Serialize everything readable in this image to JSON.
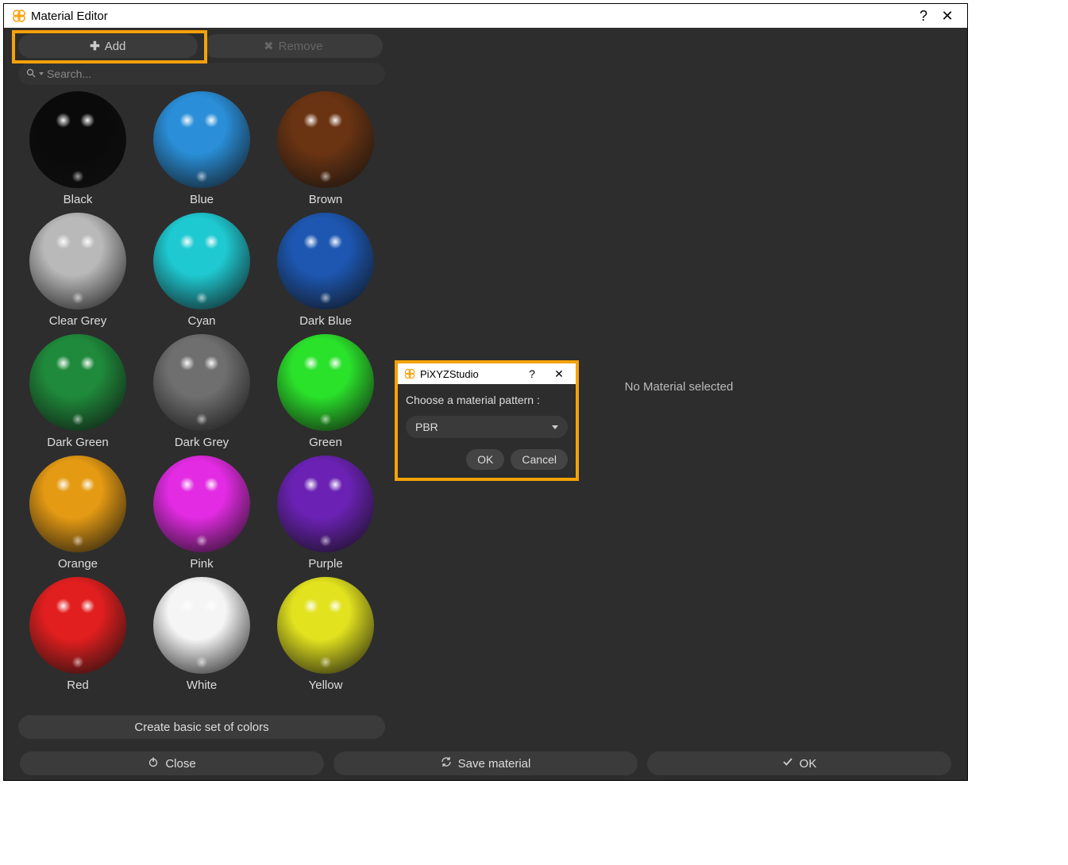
{
  "window": {
    "title": "Material Editor",
    "help": "?",
    "close": "✕"
  },
  "toolbar": {
    "add_label": "Add",
    "remove_label": "Remove"
  },
  "search": {
    "placeholder": "Search..."
  },
  "materials": [
    {
      "label": "Black",
      "color": "#0a0a0a"
    },
    {
      "label": "Blue",
      "color": "#2a8fd8"
    },
    {
      "label": "Brown",
      "color": "#6a3413"
    },
    {
      "label": "Clear Grey",
      "color": "#b9b9b9"
    },
    {
      "label": "Cyan",
      "color": "#1fc9d1"
    },
    {
      "label": "Dark Blue",
      "color": "#1d57b1"
    },
    {
      "label": "Dark Green",
      "color": "#1f8a3b"
    },
    {
      "label": "Dark Grey",
      "color": "#6f6f6f"
    },
    {
      "label": "Green",
      "color": "#2be22b"
    },
    {
      "label": "Orange",
      "color": "#e49a13"
    },
    {
      "label": "Pink",
      "color": "#e22be2"
    },
    {
      "label": "Purple",
      "color": "#6b22b4"
    },
    {
      "label": "Red",
      "color": "#e21f1f"
    },
    {
      "label": "White",
      "color": "#f5f5f5"
    },
    {
      "label": "Yellow",
      "color": "#e2e21f"
    }
  ],
  "create_label": "Create basic set of colors",
  "right_pane": {
    "empty_text": "No Material selected"
  },
  "footer": {
    "close_label": "Close",
    "save_label": "Save material",
    "ok_label": "OK"
  },
  "dialog": {
    "title": "PiXYZStudio",
    "help": "?",
    "close": "✕",
    "prompt": "Choose a material pattern :",
    "selected": "PBR",
    "ok_label": "OK",
    "cancel_label": "Cancel"
  }
}
